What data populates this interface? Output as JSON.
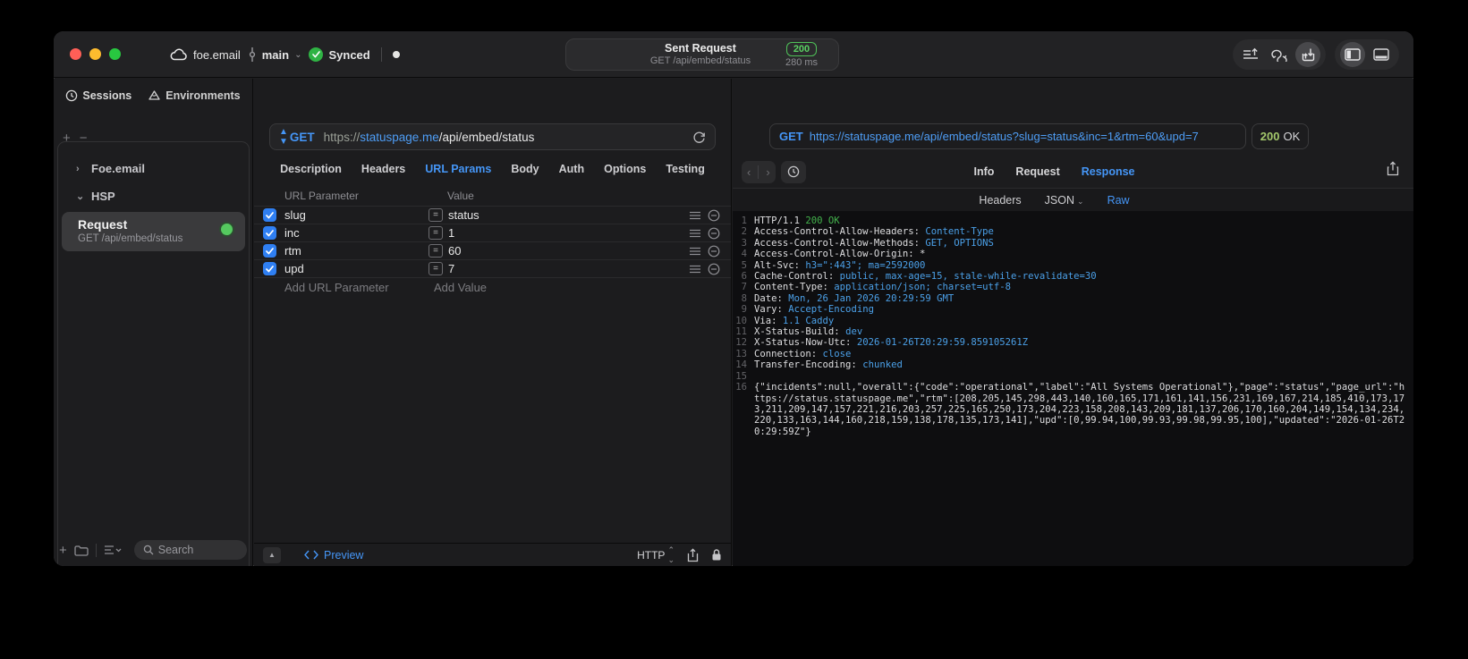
{
  "titlebar": {
    "cloud_label": "foe.email",
    "branch_label": "main",
    "sync_label": "Synced",
    "center": {
      "title": "Sent Request",
      "subtitle": "GET /api/embed/status",
      "status_code": "200",
      "duration": "280 ms"
    }
  },
  "sidebar": {
    "tabs": [
      {
        "label": "Sessions"
      },
      {
        "label": "Environments"
      }
    ],
    "tree": [
      {
        "label": "Foe.email",
        "chevron": "›"
      },
      {
        "label": "HSP",
        "chevron": "⌄"
      }
    ],
    "selected_request": {
      "name": "Request",
      "subtitle": "GET /api/embed/status"
    },
    "search_label": "Search"
  },
  "request_panel": {
    "method": "GET",
    "url_scheme": "https://",
    "url_host": "statuspage.me",
    "url_path": "/api/embed/status",
    "tabs": [
      "Description",
      "Headers",
      "URL Params",
      "Body",
      "Auth",
      "Options",
      "Testing"
    ],
    "active_tab": "URL Params",
    "params_table": {
      "columns": [
        "URL Parameter",
        "Value"
      ],
      "rows": [
        {
          "name": "slug",
          "value": "status",
          "enabled": true
        },
        {
          "name": "inc",
          "value": "1",
          "enabled": true
        },
        {
          "name": "rtm",
          "value": "60",
          "enabled": true
        },
        {
          "name": "upd",
          "value": "7",
          "enabled": true
        }
      ],
      "add_param_label": "Add URL Parameter",
      "add_value_label": "Add Value"
    },
    "footer": {
      "preview_label": "Preview",
      "http_label": "HTTP"
    }
  },
  "response_panel": {
    "request_line": {
      "method": "GET",
      "url": "https://statuspage.me/api/embed/status?slug=status&inc=1&rtm=60&upd=7"
    },
    "status": {
      "code": "200",
      "text": "OK"
    },
    "tabs": [
      "Info",
      "Request",
      "Response"
    ],
    "active_tab": "Response",
    "subtabs": [
      "Headers",
      "JSON",
      "Raw"
    ],
    "active_subtab": "Raw",
    "raw_lines": [
      {
        "n": "1",
        "parts": [
          [
            "p",
            "HTTP/1.1 "
          ],
          [
            "s",
            "200 OK"
          ]
        ]
      },
      {
        "n": "2",
        "parts": [
          [
            "p",
            "Access-Control-Allow-Headers: "
          ],
          [
            "v",
            "Content-Type"
          ]
        ]
      },
      {
        "n": "3",
        "parts": [
          [
            "p",
            "Access-Control-Allow-Methods: "
          ],
          [
            "v",
            "GET, OPTIONS"
          ]
        ]
      },
      {
        "n": "4",
        "parts": [
          [
            "p",
            "Access-Control-Allow-Origin: *"
          ]
        ]
      },
      {
        "n": "5",
        "parts": [
          [
            "p",
            "Alt-Svc: "
          ],
          [
            "v",
            "h3=\":443\"; ma=2592000"
          ]
        ]
      },
      {
        "n": "6",
        "parts": [
          [
            "p",
            "Cache-Control: "
          ],
          [
            "v",
            "public, max-age=15, stale-while-revalidate=30"
          ]
        ]
      },
      {
        "n": "7",
        "parts": [
          [
            "p",
            "Content-Type: "
          ],
          [
            "v",
            "application/json; charset=utf-8"
          ]
        ]
      },
      {
        "n": "8",
        "parts": [
          [
            "p",
            "Date: "
          ],
          [
            "v",
            "Mon, 26 Jan 2026 20:29:59 GMT"
          ]
        ]
      },
      {
        "n": "9",
        "parts": [
          [
            "p",
            "Vary: "
          ],
          [
            "v",
            "Accept-Encoding"
          ]
        ]
      },
      {
        "n": "10",
        "parts": [
          [
            "p",
            "Via: "
          ],
          [
            "v",
            "1.1 Caddy"
          ]
        ]
      },
      {
        "n": "11",
        "parts": [
          [
            "p",
            "X-Status-Build: "
          ],
          [
            "v",
            "dev"
          ]
        ]
      },
      {
        "n": "12",
        "parts": [
          [
            "p",
            "X-Status-Now-Utc: "
          ],
          [
            "v",
            "2026-01-26T20:29:59.859105261Z"
          ]
        ]
      },
      {
        "n": "13",
        "parts": [
          [
            "p",
            "Connection: "
          ],
          [
            "v",
            "close"
          ]
        ]
      },
      {
        "n": "14",
        "parts": [
          [
            "p",
            "Transfer-Encoding: "
          ],
          [
            "v",
            "chunked"
          ]
        ]
      },
      {
        "n": "15",
        "parts": []
      },
      {
        "n": "16",
        "parts": [
          [
            "p",
            "{\"incidents\":null,\"overall\":{\"code\":\"operational\",\"label\":\"All Systems Operational\"},\"page\":\"status\",\"page_url\":\"https://status.statuspage.me\",\"rtm\":[208,205,145,298,443,140,160,165,171,161,141,156,231,169,167,214,185,410,173,173,211,209,147,157,221,216,203,257,225,165,250,173,204,223,158,208,143,209,181,137,206,170,160,204,149,154,134,234,220,133,163,144,160,218,159,138,178,135,173,141],\"upd\":[0,99.94,100,99.93,99.98,99.95,100],\"updated\":\"2026-01-26T20:29:59Z\"}"
          ]
        ]
      }
    ]
  }
}
